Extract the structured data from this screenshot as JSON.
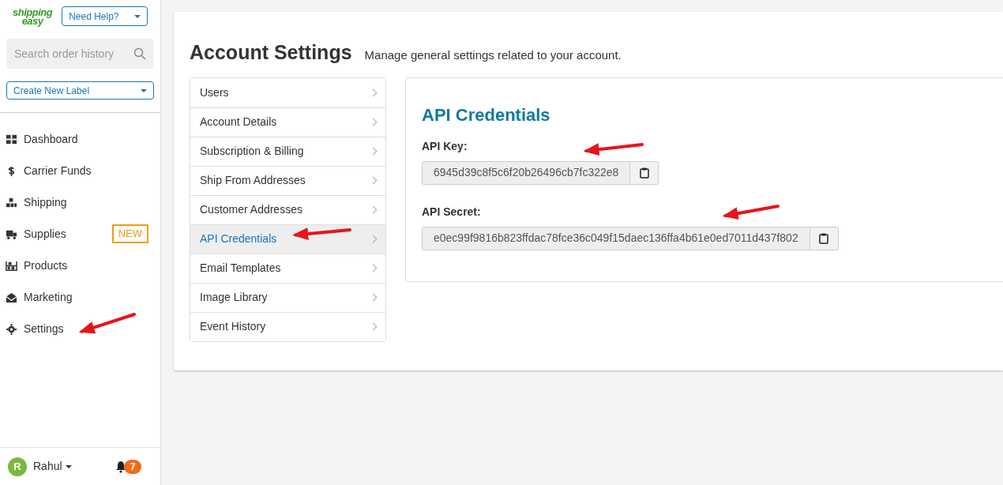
{
  "sidebar": {
    "logo": {
      "top": "shipping",
      "bottom": "easy"
    },
    "help_button": "Need Help?",
    "search": {
      "placeholder": "Search order history"
    },
    "create_label_button": "Create New Label",
    "nav": [
      {
        "label": "Dashboard"
      },
      {
        "label": "Carrier Funds"
      },
      {
        "label": "Shipping"
      },
      {
        "label": "Supplies",
        "badge": "NEW"
      },
      {
        "label": "Products"
      },
      {
        "label": "Marketing"
      },
      {
        "label": "Settings"
      }
    ],
    "user": {
      "initial": "R",
      "name": "Rahul"
    },
    "notifications": "7"
  },
  "page": {
    "title": "Account Settings",
    "subtitle": "Manage general settings related to your account.",
    "menu": [
      {
        "label": "Users",
        "selected": false
      },
      {
        "label": "Account Details",
        "selected": false
      },
      {
        "label": "Subscription & Billing",
        "selected": false
      },
      {
        "label": "Ship From Addresses",
        "selected": false
      },
      {
        "label": "Customer Addresses",
        "selected": false
      },
      {
        "label": "API Credentials",
        "selected": true
      },
      {
        "label": "Email Templates",
        "selected": false
      },
      {
        "label": "Image Library",
        "selected": false
      },
      {
        "label": "Event History",
        "selected": false
      }
    ],
    "panel": {
      "title": "API Credentials",
      "fields": [
        {
          "label": "API Key:",
          "value": "6945d39c8f5c6f20b26496cb7fc322e8"
        },
        {
          "label": "API Secret:",
          "value": "e0ec99f9816b823ffdac78fce36c049f15daec136ffa4b61e0ed7011d437f802"
        }
      ]
    }
  }
}
